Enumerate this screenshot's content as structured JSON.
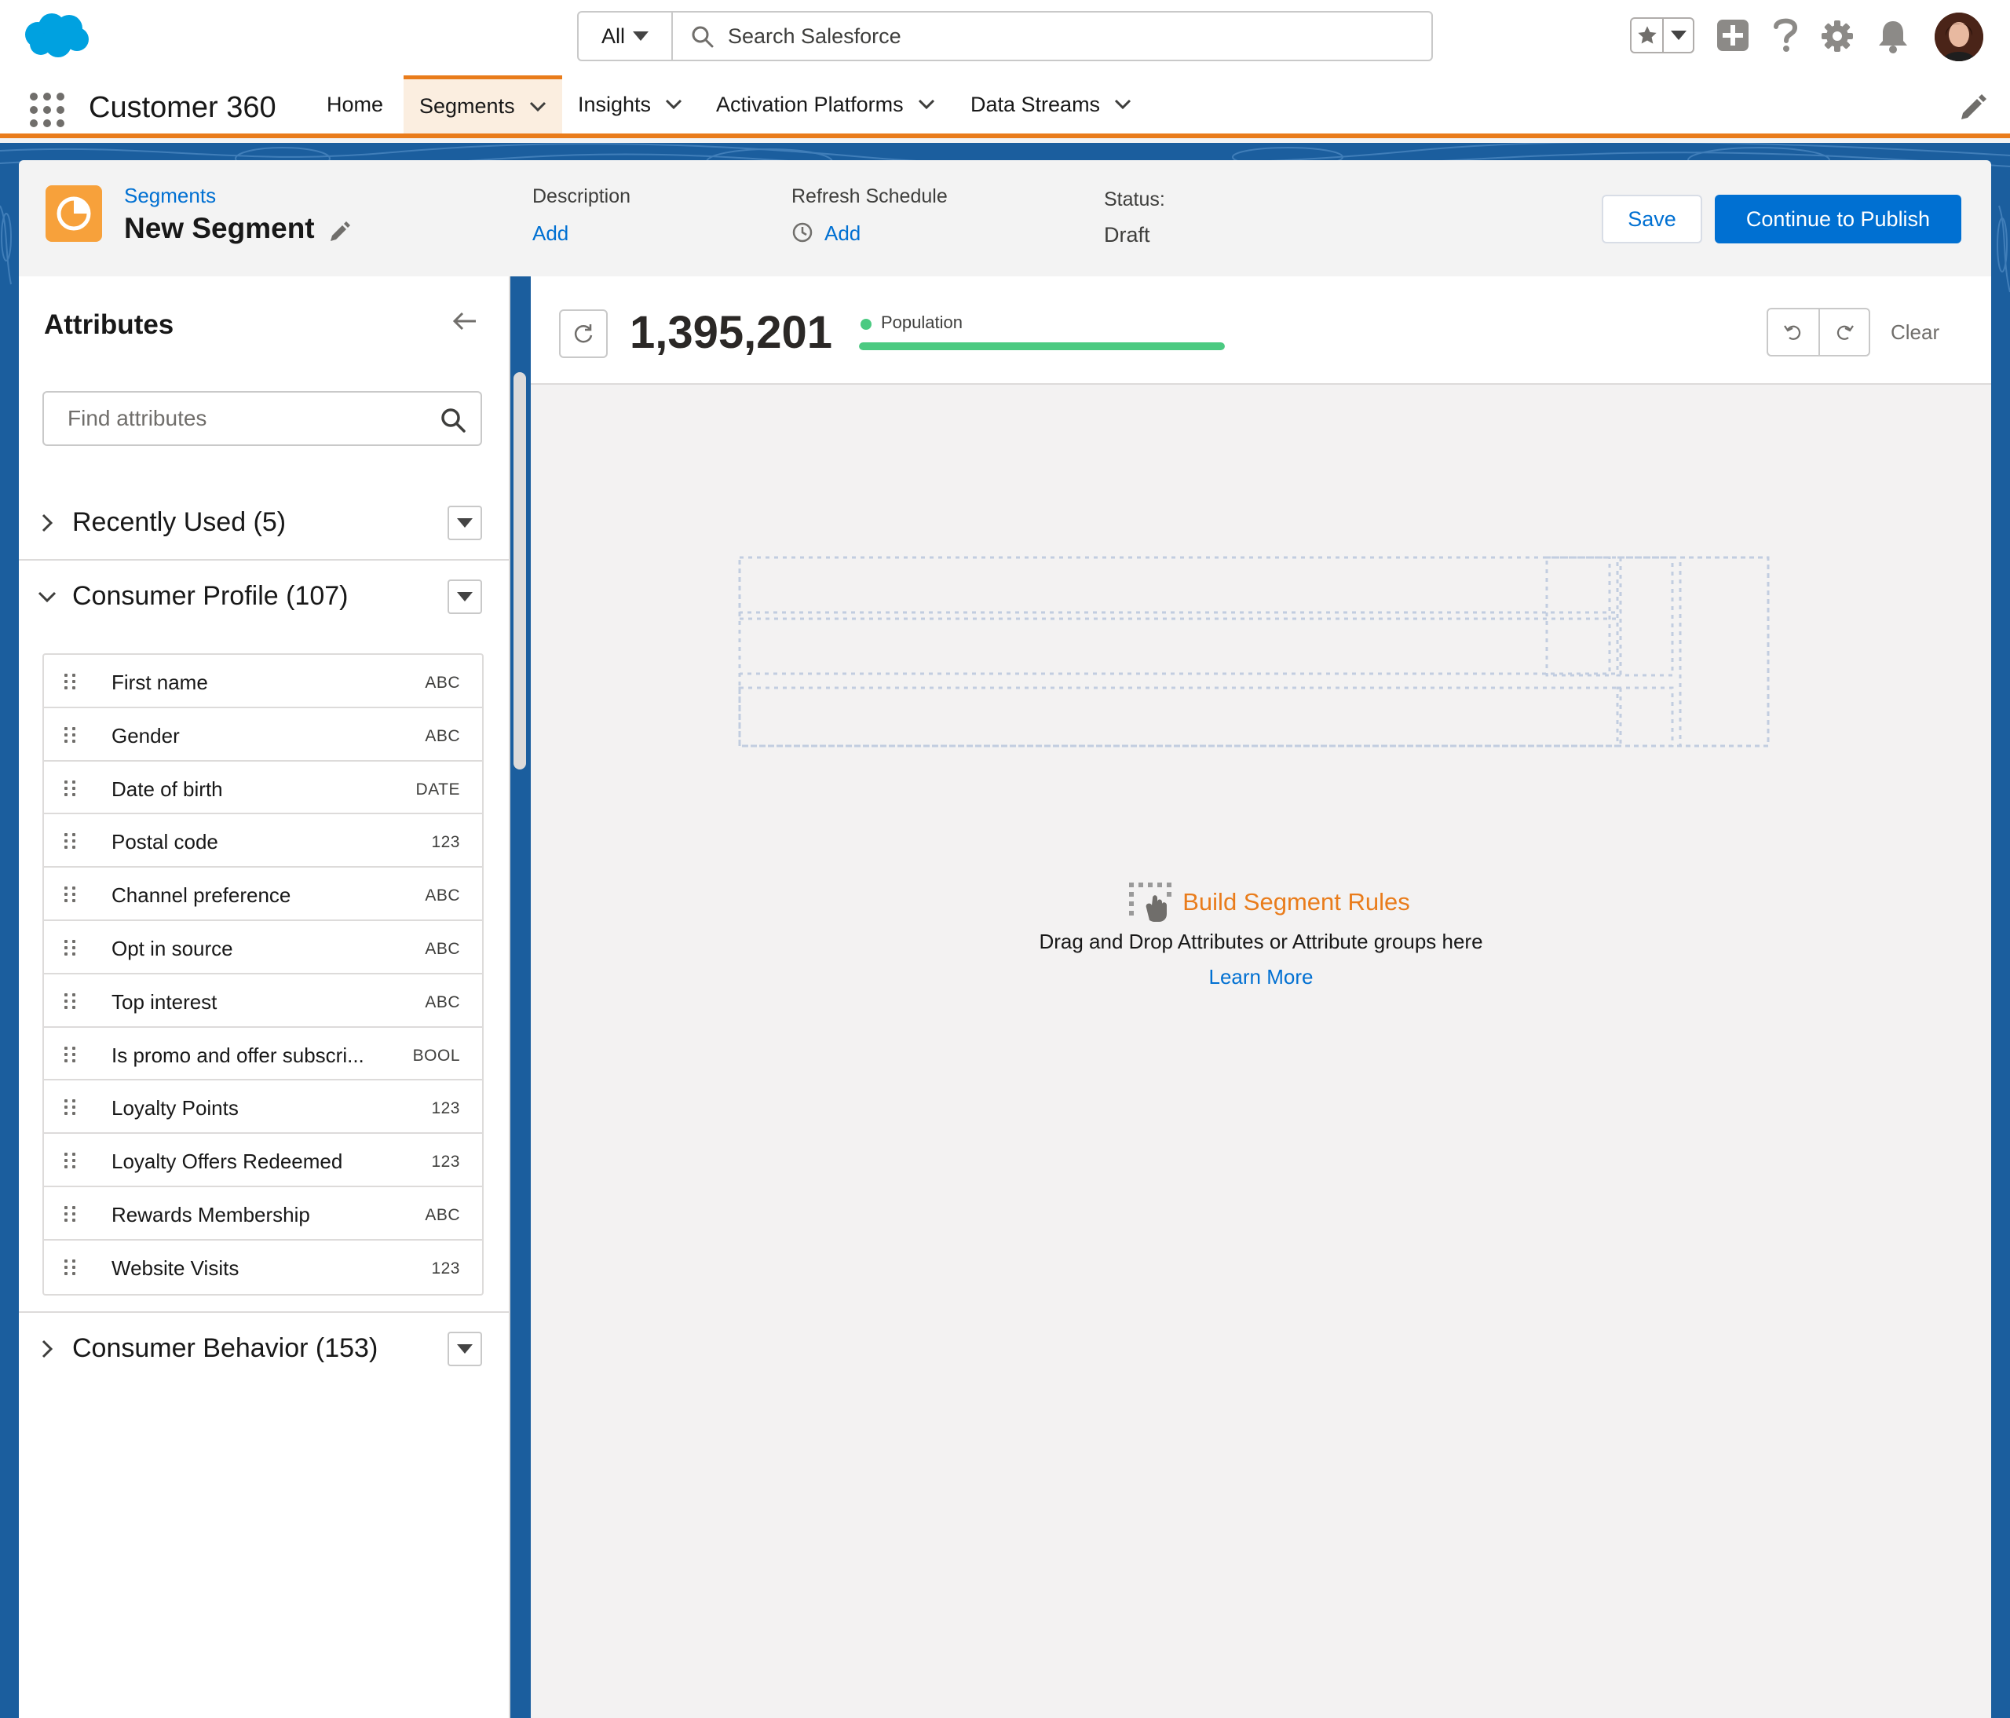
{
  "global_header": {
    "search_scope": "All",
    "search_placeholder": "Search Salesforce"
  },
  "app_nav": {
    "app_name": "Customer 360",
    "tabs": [
      {
        "label": "Home"
      },
      {
        "label": "Segments"
      },
      {
        "label": "Insights"
      },
      {
        "label": "Activation Platforms"
      },
      {
        "label": "Data Streams"
      }
    ]
  },
  "page_header": {
    "breadcrumb": "Segments",
    "title": "New Segment",
    "description_label": "Description",
    "description_link": "Add",
    "refresh_label": "Refresh Schedule",
    "refresh_link": "Add",
    "status_label": "Status:",
    "status_value": "Draft",
    "save_label": "Save",
    "publish_label": "Continue to Publish"
  },
  "sidebar": {
    "title": "Attributes",
    "find_placeholder": "Find attributes",
    "groups": [
      {
        "label": "Recently Used (5)"
      },
      {
        "label": "Consumer Profile (107)"
      },
      {
        "label": "Consumer Behavior (153)"
      }
    ],
    "attributes": [
      {
        "label": "First name",
        "type": "ABC"
      },
      {
        "label": "Gender",
        "type": "ABC"
      },
      {
        "label": "Date of birth",
        "type": "DATE"
      },
      {
        "label": "Postal code",
        "type": "123"
      },
      {
        "label": "Channel preference",
        "type": "ABC"
      },
      {
        "label": "Opt in source",
        "type": "ABC"
      },
      {
        "label": "Top interest",
        "type": "ABC"
      },
      {
        "label": "Is promo and offer subscri...",
        "type": "BOOL"
      },
      {
        "label": "Loyalty Points",
        "type": "123"
      },
      {
        "label": "Loyalty Offers Redeemed",
        "type": "123"
      },
      {
        "label": "Rewards Membership",
        "type": "ABC"
      },
      {
        "label": "Website Visits",
        "type": "123"
      }
    ]
  },
  "main": {
    "population_count": "1,395,201",
    "population_label": "Population",
    "population_fill": 1.0,
    "clear_label": "Clear",
    "build_title": "Build Segment Rules",
    "build_desc": "Drag and Drop Attributes or Attribute groups here",
    "learn_more": "Learn More"
  },
  "colors": {
    "brand_blue": "#0070d2",
    "nav_accent": "#e97c1b",
    "success_green": "#4bca81",
    "segment_icon": "#f7a13b"
  }
}
